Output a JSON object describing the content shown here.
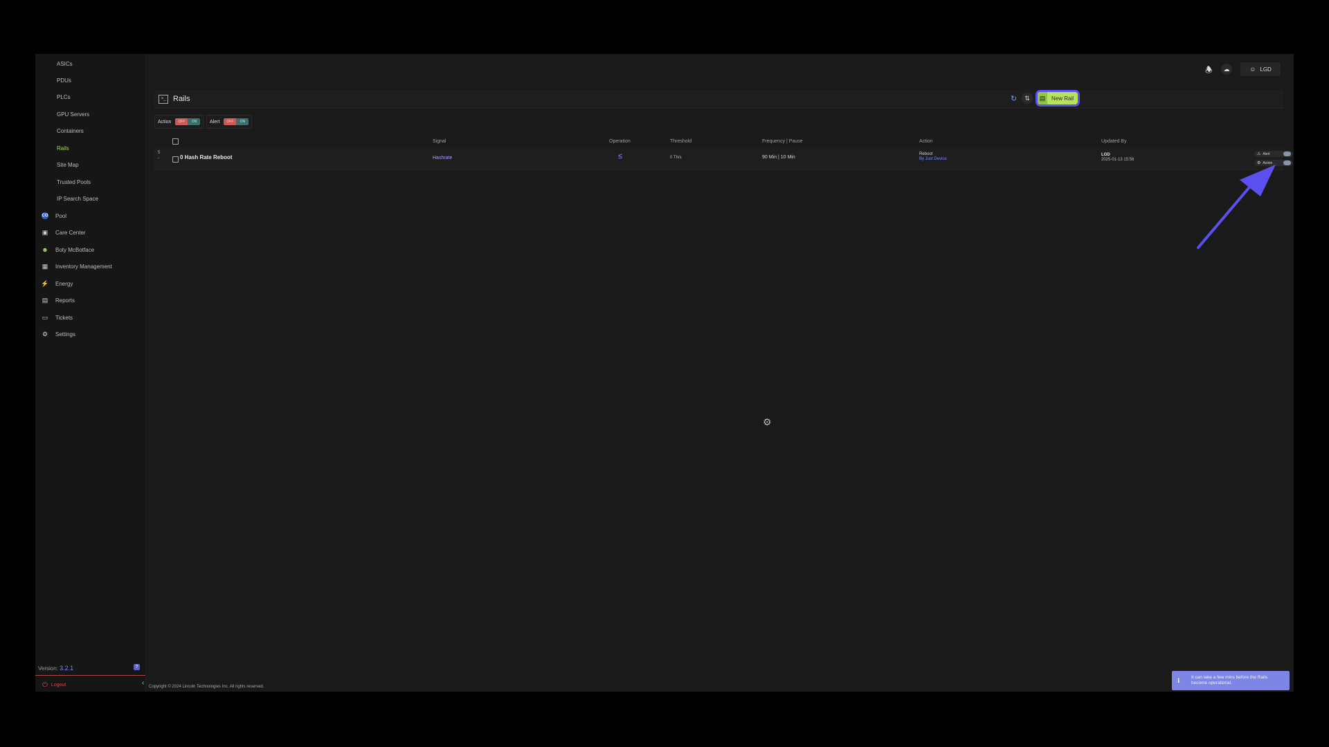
{
  "sidebar": {
    "items": [
      {
        "label": "ASICs",
        "type": "sub"
      },
      {
        "label": "PDUs",
        "type": "sub"
      },
      {
        "label": "PLCs",
        "type": "sub"
      },
      {
        "label": "GPU Servers",
        "type": "sub"
      },
      {
        "label": "Containers",
        "type": "sub"
      },
      {
        "label": "Rails",
        "type": "sub",
        "active": true
      },
      {
        "label": "Site Map",
        "type": "sub"
      },
      {
        "label": "Trusted Pools",
        "type": "sub"
      },
      {
        "label": "IP Search Space",
        "type": "sub"
      },
      {
        "label": "Pool",
        "type": "main",
        "icon": "pool-icon"
      },
      {
        "label": "Care Center",
        "type": "main",
        "icon": "care-center-icon"
      },
      {
        "label": "Boty McBotface",
        "type": "main",
        "icon": "bot-icon"
      },
      {
        "label": "Inventory Management",
        "type": "main",
        "icon": "inventory-icon"
      },
      {
        "label": "Energy",
        "type": "main",
        "icon": "lightning-icon"
      },
      {
        "label": "Reports",
        "type": "main",
        "icon": "document-icon"
      },
      {
        "label": "Tickets",
        "type": "main",
        "icon": "ticket-icon"
      },
      {
        "label": "Settings",
        "type": "main",
        "icon": "settings-icon"
      }
    ],
    "pool_icon_text": "CO",
    "version_label": "Version:",
    "version_number": "3.2.1",
    "help_badge": "?",
    "logout_label": "Logout"
  },
  "topbar": {
    "user_label": "LGD"
  },
  "panel": {
    "title": "Rails",
    "new_rail_label": "New Rail"
  },
  "filters": {
    "action_label": "Action",
    "alert_label": "Alert",
    "off_label": "OFF",
    "on_label": "ON"
  },
  "table": {
    "headers": {
      "signal": "Signal",
      "operation": "Operation",
      "threshold": "Threshold",
      "frequency": "Frequency | Pause",
      "action": "Action",
      "updated_by": "Updated By"
    },
    "rows": [
      {
        "num": "5",
        "num_sub": "-",
        "name": "0 Hash Rate Reboot",
        "signal": "Hashrate",
        "operation": "≤",
        "threshold": "0 Th/s",
        "frequency": "90 Min | 10 Min",
        "action": "Reboot",
        "action_sub": "By Just Device",
        "updated_user": "LGD",
        "updated_date": "2025-01-13 15:56",
        "alert_chip": "Alert",
        "action_chip": "Action"
      }
    ]
  },
  "footer": {
    "copyright": "Copyright © 2024 Lincoln Technologies Inc. All rights reserved."
  },
  "toast": {
    "message": "It can take a few mins before the Rails become operational."
  },
  "colors": {
    "accent_green": "#b6e35f",
    "highlight": "#5b4ff0",
    "toast_bg": "#7e86e5"
  }
}
